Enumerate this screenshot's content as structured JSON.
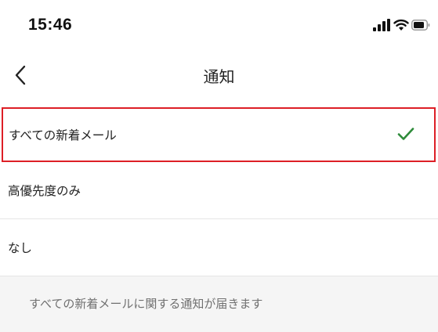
{
  "status_bar": {
    "time": "15:46",
    "icons": [
      "signal-icon",
      "wifi-icon",
      "battery-icon"
    ]
  },
  "nav": {
    "back_icon": "chevron-left-icon",
    "title": "通知"
  },
  "options": [
    {
      "label": "すべての新着メール",
      "selected": true
    },
    {
      "label": "高優先度のみ",
      "selected": false
    },
    {
      "label": "なし",
      "selected": false
    }
  ],
  "hint": "すべての新着メールに関する通知が届きます",
  "colors": {
    "check": "#2e8b3a",
    "highlight_border": "#dd1f26",
    "hint_bg": "#f5f5f5"
  }
}
